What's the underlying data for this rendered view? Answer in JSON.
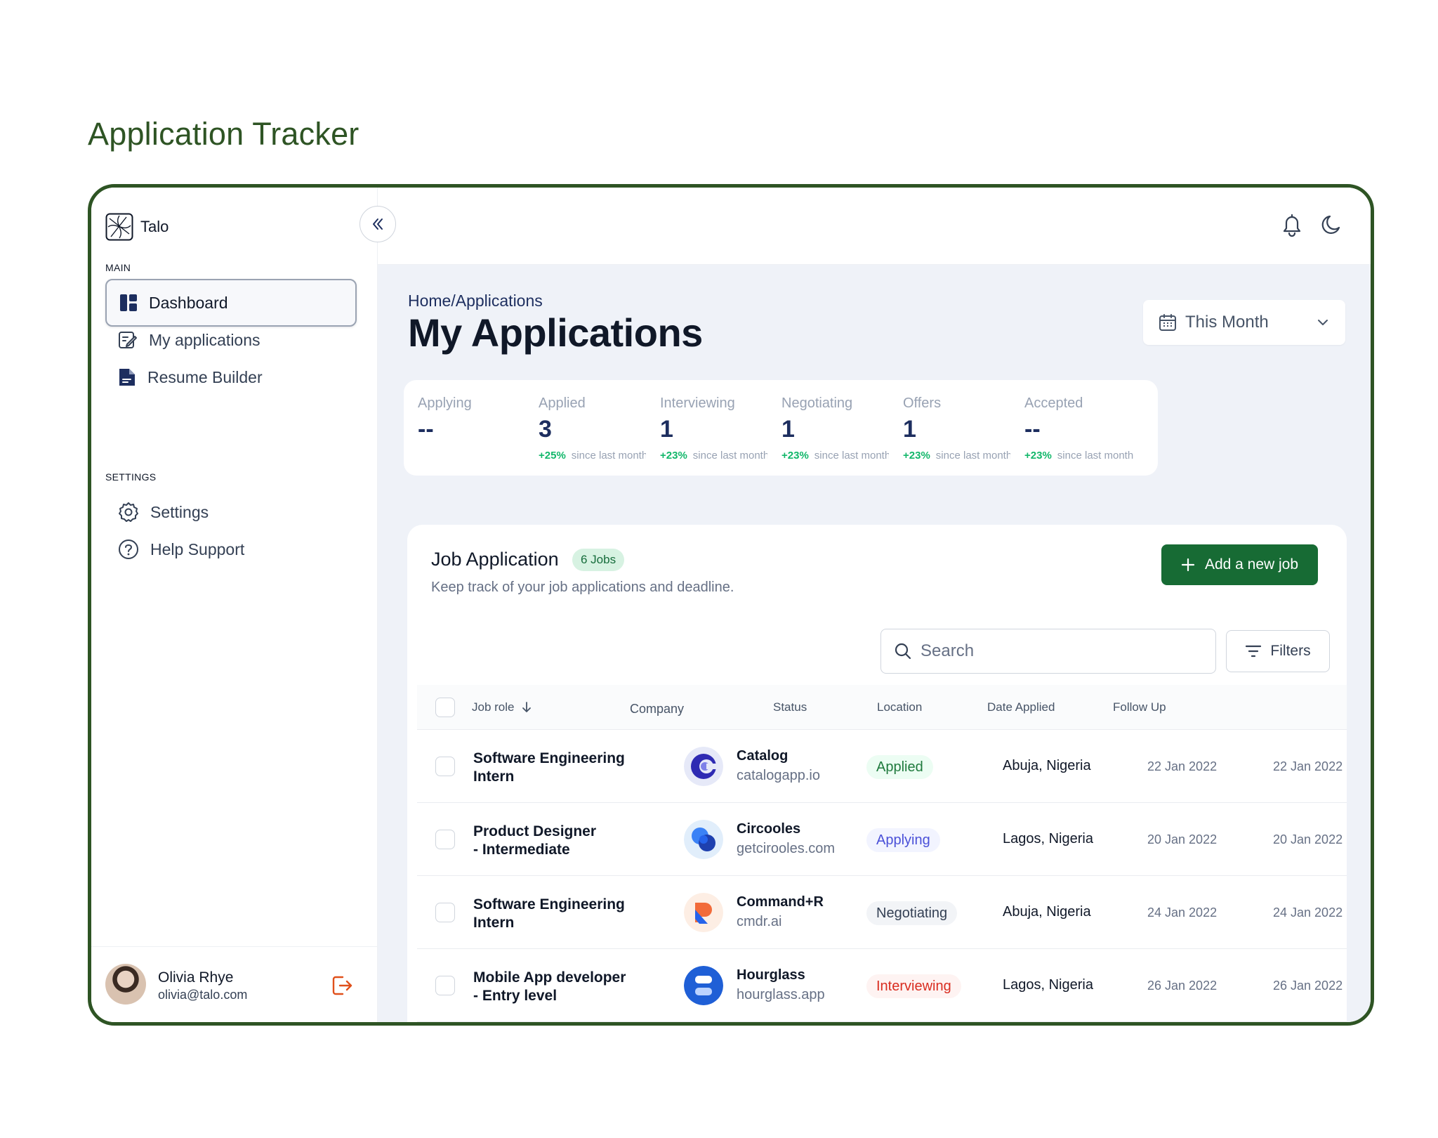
{
  "page_heading": "Application Tracker",
  "brand": {
    "name": "Talo"
  },
  "sidebar": {
    "main_label": "MAIN",
    "items": [
      {
        "label": "Dashboard",
        "icon": "dashboard-icon",
        "active": true
      },
      {
        "label": "My applications",
        "icon": "edit-document-icon"
      },
      {
        "label": "Resume Builder",
        "icon": "file-icon"
      }
    ],
    "settings_label": "SETTINGS",
    "settings_items": [
      {
        "label": "Settings",
        "icon": "gear-icon"
      },
      {
        "label": "Help Support",
        "icon": "help-circle-icon"
      }
    ],
    "user": {
      "name": "Olivia Rhye",
      "email": "olivia@talo.com"
    }
  },
  "header": {
    "breadcrumb": "Home/Applications",
    "title": "My Applications",
    "period_select": "This Month"
  },
  "stats": [
    {
      "label": "Applying",
      "value": "--",
      "delta": "",
      "since": ""
    },
    {
      "label": "Applied",
      "value": "3",
      "delta": "+25%",
      "since": "since last month"
    },
    {
      "label": "Interviewing",
      "value": "1",
      "delta": "+23%",
      "since": "since last month"
    },
    {
      "label": "Negotiating",
      "value": "1",
      "delta": "+23%",
      "since": "since last month"
    },
    {
      "label": "Offers",
      "value": "1",
      "delta": "+23%",
      "since": "since last month"
    },
    {
      "label": "Accepted",
      "value": "--",
      "delta": "+23%",
      "since": "since last month"
    }
  ],
  "panel": {
    "title": "Job Application",
    "badge": "6 Jobs",
    "subtitle": "Keep track of your job applications and deadline.",
    "add_button": "Add a new job",
    "search_placeholder": "Search",
    "filters_button": "Filters"
  },
  "table": {
    "columns": [
      "Job role",
      "Company",
      "Status",
      "Location",
      "Date Applied",
      "Follow Up"
    ],
    "rows": [
      {
        "role_1": "Software Engineering",
        "role_2": "Intern",
        "company": "Catalog",
        "domain": "catalogapp.io",
        "status": "Applied",
        "location": "Abuja, Nigeria",
        "date_applied": "22 Jan 2022",
        "follow_up": "22 Jan 2022"
      },
      {
        "role_1": "Product Designer",
        "role_2": "- Intermediate",
        "company": "Circooles",
        "domain": "getcirooles.com",
        "status": "Applying",
        "location": "Lagos, Nigeria",
        "date_applied": "20 Jan 2022",
        "follow_up": "20 Jan 2022"
      },
      {
        "role_1": "Software Engineering",
        "role_2": "Intern",
        "company": "Command+R",
        "domain": "cmdr.ai",
        "status": "Negotiating",
        "location": "Abuja, Nigeria",
        "date_applied": "24 Jan 2022",
        "follow_up": "24 Jan 2022"
      },
      {
        "role_1": "Mobile App developer",
        "role_2": "- Entry level",
        "company": "Hourglass",
        "domain": "hourglass.app",
        "status": "Interviewing",
        "location": "Lagos, Nigeria",
        "date_applied": "26 Jan 2022",
        "follow_up": "26 Jan 2022"
      }
    ]
  },
  "colors": {
    "brand_green": "#2e5424",
    "primary_button": "#176b34",
    "positive": "#12b76a",
    "main_bg": "#eff2f8"
  }
}
